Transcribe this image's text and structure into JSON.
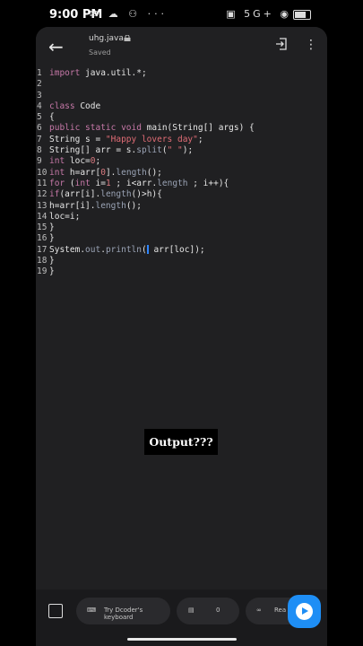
{
  "status": {
    "time": "9:00 PM",
    "network": "5G+"
  },
  "editor": {
    "filename": "uhg.java",
    "save_state": "Saved",
    "lines": [
      {
        "n": "1",
        "t": "import java.util.*;"
      },
      {
        "n": "2",
        "t": ""
      },
      {
        "n": "3",
        "t": ""
      },
      {
        "n": "4",
        "t": "class Code"
      },
      {
        "n": "5",
        "t": "{"
      },
      {
        "n": "6",
        "t": "public static void main(String[] args) {"
      },
      {
        "n": "7",
        "t": "String s = \"Happy lovers day\";"
      },
      {
        "n": "8",
        "t": "String[] arr = s.split(\" \");"
      },
      {
        "n": "9",
        "t": "int loc=0;"
      },
      {
        "n": "10",
        "t": "int h=arr[0].length();"
      },
      {
        "n": "11",
        "t": "for (int i=1 ; i<arr.length ; i++){"
      },
      {
        "n": "12",
        "t": "if(arr[i].length()>h){"
      },
      {
        "n": "13",
        "t": "h=arr[i].length();"
      },
      {
        "n": "14",
        "t": "loc=i;"
      },
      {
        "n": "15",
        "t": "}"
      },
      {
        "n": "16",
        "t": "}"
      },
      {
        "n": "17",
        "t": "System.out.println( arr[loc]);"
      },
      {
        "n": "18",
        "t": "}"
      },
      {
        "n": "19",
        "t": "}"
      }
    ]
  },
  "overlay": {
    "caption": "Output???"
  },
  "bottom": {
    "keyboard_label": "Try Dcoder's keyboard",
    "comments_count": "0",
    "read_label": "Rea"
  },
  "colors": {
    "accent": "#1e8ef5",
    "keyword": "#c678a8",
    "string": "#e06c75"
  }
}
